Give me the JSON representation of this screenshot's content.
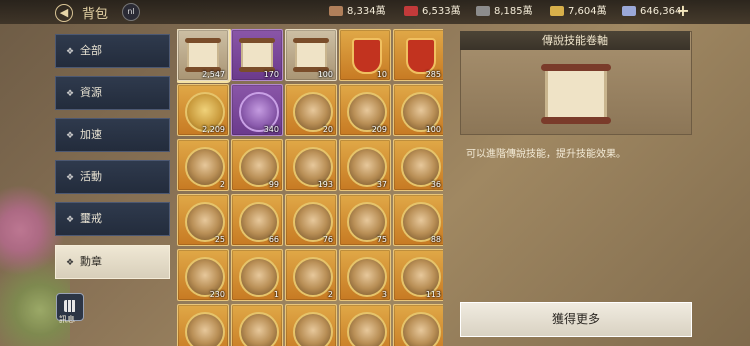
{
  "header": {
    "back_icon": "back-arrow-icon",
    "title": "背包",
    "level_badge": "nl"
  },
  "resources": [
    {
      "icon": "meat-icon",
      "value": "8,334萬",
      "color": "#b07f5a"
    },
    {
      "icon": "ruby-icon",
      "value": "6,533萬",
      "color": "#c23a3a"
    },
    {
      "icon": "iron-icon",
      "value": "8,185萬",
      "color": "#8c8c8c"
    },
    {
      "icon": "gold-bar-icon",
      "value": "7,604萬",
      "color": "#d8b04a"
    },
    {
      "icon": "gem-icon",
      "value": "646,364",
      "color": "#9aa8d8"
    }
  ],
  "sidebar": {
    "items": [
      {
        "label": "全部",
        "active": false
      },
      {
        "label": "資源",
        "active": false
      },
      {
        "label": "加速",
        "active": false
      },
      {
        "label": "活動",
        "active": false
      },
      {
        "label": "璽戒",
        "active": false
      },
      {
        "label": "勳章",
        "active": true
      }
    ],
    "message_label": "訊息"
  },
  "items": [
    {
      "type": "scroll",
      "frame": "white",
      "count": "2,547",
      "selected": true
    },
    {
      "type": "scroll",
      "frame": "purple",
      "count": "170"
    },
    {
      "type": "scroll",
      "frame": "white",
      "count": "100"
    },
    {
      "type": "shield",
      "frame": "gold",
      "count": "10"
    },
    {
      "type": "shield",
      "frame": "gold",
      "count": "285"
    },
    {
      "type": "coin",
      "frame": "gold",
      "count": "2,209"
    },
    {
      "type": "pcoin",
      "frame": "purple",
      "count": "340"
    },
    {
      "type": "medal",
      "frame": "gold",
      "count": "20"
    },
    {
      "type": "medal",
      "frame": "gold",
      "count": "209"
    },
    {
      "type": "medal",
      "frame": "gold",
      "count": "100"
    },
    {
      "type": "medal",
      "frame": "gold",
      "count": "2"
    },
    {
      "type": "medal",
      "frame": "gold",
      "count": "99"
    },
    {
      "type": "medal",
      "frame": "gold",
      "count": "193"
    },
    {
      "type": "medal",
      "frame": "gold",
      "count": "37"
    },
    {
      "type": "medal",
      "frame": "gold",
      "count": "36"
    },
    {
      "type": "medal",
      "frame": "gold",
      "count": "25"
    },
    {
      "type": "medal",
      "frame": "gold",
      "count": "66"
    },
    {
      "type": "medal",
      "frame": "gold",
      "count": "76"
    },
    {
      "type": "medal",
      "frame": "gold",
      "count": "75"
    },
    {
      "type": "medal",
      "frame": "gold",
      "count": "88"
    },
    {
      "type": "medal",
      "frame": "gold",
      "count": "230"
    },
    {
      "type": "medal",
      "frame": "gold",
      "count": "1"
    },
    {
      "type": "medal",
      "frame": "gold",
      "count": "2"
    },
    {
      "type": "medal",
      "frame": "gold",
      "count": "3"
    },
    {
      "type": "medal",
      "frame": "gold",
      "count": "113"
    },
    {
      "type": "medal",
      "frame": "gold",
      "count": ""
    },
    {
      "type": "medal",
      "frame": "gold",
      "count": ""
    },
    {
      "type": "medal",
      "frame": "gold",
      "count": ""
    },
    {
      "type": "medal",
      "frame": "gold",
      "count": ""
    },
    {
      "type": "medal",
      "frame": "gold",
      "count": ""
    }
  ],
  "detail": {
    "title": "傳說技能卷軸",
    "description": "可以進階傳說技能，提升技能效果。",
    "get_more_label": "獲得更多"
  }
}
